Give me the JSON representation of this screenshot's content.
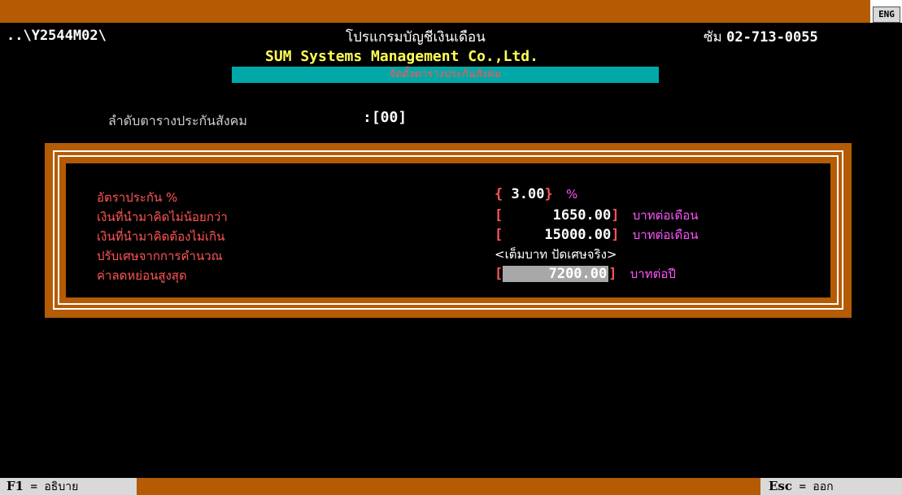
{
  "header": {
    "path": "..\\Y2544M02\\",
    "program_title": "โปรแกรมบัญชีเงินเดือน",
    "phone_label": "ซัม",
    "phone_number": "02-713-0055",
    "lang_badge": "ENG"
  },
  "company": "SUM Systems Management Co.,Ltd.",
  "subtitle": "จัดตั้งตารางประกันสังคม",
  "table_field": {
    "label": "ลำดับตารางประกันสังคม",
    "value": ":[00]"
  },
  "settings": [
    {
      "label": "อัตราประกัน %",
      "open": "{",
      "value": " 3.00",
      "close": "}",
      "unit": "%"
    },
    {
      "label": "เงินที่นำมาคิดไม่น้อยกว่า",
      "open": "[",
      "value": "1650.00",
      "close": "]",
      "unit": "บาทต่อเดือน"
    },
    {
      "label": "เงินที่นำมาคิดต้องไม่เกิน",
      "open": "[",
      "value": "15000.00",
      "close": "]",
      "unit": "บาทต่อเดือน"
    },
    {
      "label": "ปรับเศษจากการคำนวณ",
      "open": "<",
      "value": "เต็มบาท ปัดเศษจริง",
      "close": ">"
    },
    {
      "label": "ค่าลดหย่อนสูงสุด",
      "open": "[",
      "value": "7200.00",
      "close": "]",
      "unit": "บาทต่อปี"
    }
  ],
  "footer": {
    "help_key": "F1",
    "help_label": "= อธิบาย",
    "exit_key": "Esc",
    "exit_label": "= ออก"
  },
  "colors": {
    "background": "#000000",
    "frame": "#b45b04",
    "title_bar": "#00a8a8",
    "label": "#ff5555",
    "unit": "#ff55ff",
    "company": "#ffff55",
    "highlight": "#a8a8a8"
  }
}
